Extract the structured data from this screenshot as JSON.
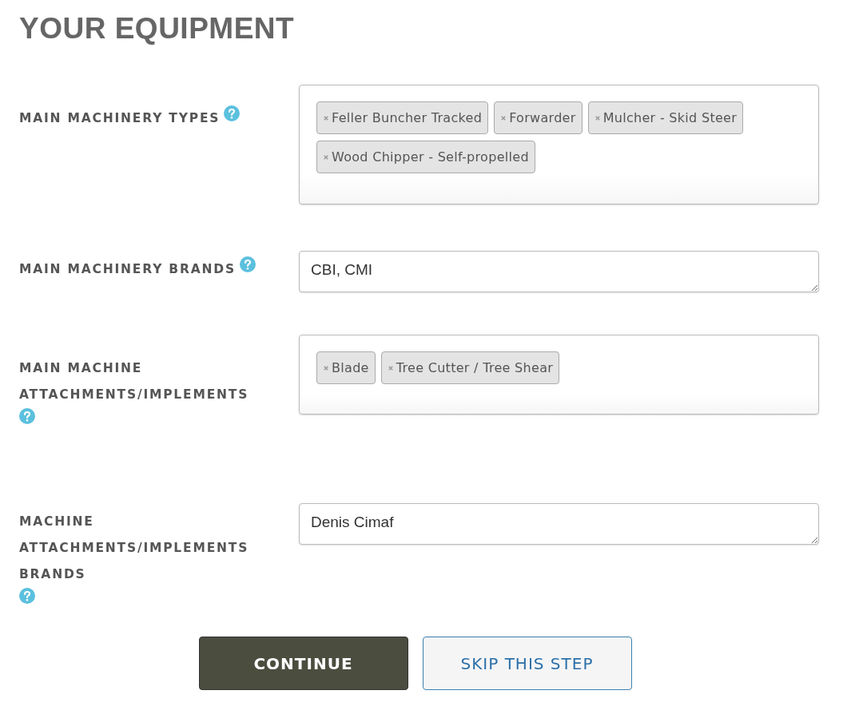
{
  "title": "YOUR EQUIPMENT",
  "fields": [
    {
      "label": "MAIN MACHINERY TYPES",
      "kind": "tags",
      "tags": [
        "Feller Buncher Tracked",
        "Forwarder",
        "Mulcher - Skid Steer",
        "Wood Chipper - Self-propelled"
      ]
    },
    {
      "label": "MAIN MACHINERY BRANDS",
      "kind": "text",
      "value": "CBI, CMI"
    },
    {
      "label": "MAIN MACHINE ATTACHMENTS/IMPLEMENTS",
      "kind": "tags",
      "tags": [
        "Blade",
        "Tree Cutter / Tree Shear"
      ]
    },
    {
      "label": "MACHINE ATTACHMENTS/IMPLEMENTS BRANDS",
      "kind": "text",
      "value": "Denis Cimaf"
    }
  ],
  "buttons": [
    {
      "label": "CONTINUE",
      "kind": "primary"
    },
    {
      "label": "SKIP THIS STEP",
      "kind": "secondary"
    }
  ]
}
